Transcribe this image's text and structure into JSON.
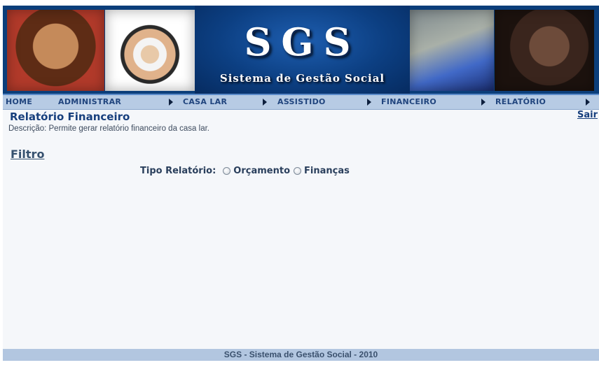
{
  "banner": {
    "logo_text": "SGS",
    "subtitle": "Sistema de Gestão Social"
  },
  "menu": {
    "items": [
      {
        "label": "HOME",
        "has_arrow": false
      },
      {
        "label": "ADMINISTRAR",
        "has_arrow": true
      },
      {
        "label": "CASA LAR",
        "has_arrow": true
      },
      {
        "label": "ASSISTIDO",
        "has_arrow": true
      },
      {
        "label": "FINANCEIRO",
        "has_arrow": true
      },
      {
        "label": "RELATÓRIO",
        "has_arrow": true
      }
    ]
  },
  "page": {
    "title": "Relatório Financeiro",
    "description": "Descrição: Permite gerar relatório financeiro da casa lar.",
    "logout_label": "Sair"
  },
  "filter": {
    "title": "Filtro",
    "type_label": "Tipo Relatório:",
    "options": [
      {
        "label": "Orçamento",
        "selected": false
      },
      {
        "label": "Finanças",
        "selected": false
      }
    ]
  },
  "footer": {
    "text": "SGS - Sistema de Gestão Social - 2010"
  },
  "colors": {
    "banner": "#0b3e7a",
    "menu_bg": "#b7cbe4",
    "menu_text": "#21457e",
    "title_text": "#173f7d",
    "footer_bg": "#b2c6e0"
  }
}
